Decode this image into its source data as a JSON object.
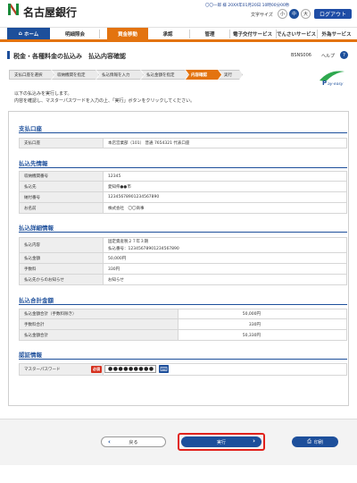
{
  "header": {
    "bank_name": "名古屋銀行",
    "user_name": "〇〇一郎 様",
    "last_login": "20XX年01月20日 10時00分00秒",
    "font_size_label": "文字サイズ",
    "font_sizes": [
      "小",
      "中",
      "大"
    ],
    "logout": "ログアウト"
  },
  "nav": {
    "items": [
      "ホーム",
      "明細照会",
      "資金移動",
      "承認",
      "管理",
      "電子交付サービス",
      "でんさいサービス",
      "外為サービス"
    ]
  },
  "page": {
    "title": "税金・各種料金の払込み　払込内容確認",
    "screen_id": "BSNS006",
    "help": "ヘルプ"
  },
  "steps": [
    "支払口座を選択",
    "収納機関を指定",
    "払込情報を入力",
    "払込金額を指定",
    "内容確認",
    "実行"
  ],
  "instructions": [
    "以下の払込みを実行します。",
    "内容を確認し、マスターパスワードを入力の上、「実行」ボタンをクリックしてください。"
  ],
  "sections": {
    "account": {
      "title": "支払口座",
      "rows": [
        {
          "label": "支払口座",
          "value": "本店営業部（101） 普通 7654321 代表口座"
        }
      ]
    },
    "payee": {
      "title": "払込先情報",
      "rows": [
        {
          "label": "収納機関番号",
          "value": "12345"
        },
        {
          "label": "払込先",
          "value": "愛知県●●市"
        },
        {
          "label": "納付番号",
          "value": "12345678901234567890"
        },
        {
          "label": "お名前",
          "value": "株式会社　〇〇商事"
        }
      ]
    },
    "detail": {
      "title": "払込詳細情報",
      "rows": [
        {
          "label": "払込内容",
          "value": "固定資産税２７年３期",
          "value2": "払込番号：12345678901234567890"
        },
        {
          "label": "払込金額",
          "value": "50,000円"
        },
        {
          "label": "手数料",
          "value": "330円"
        },
        {
          "label": "払込先からのお知らせ",
          "value": "お知らせ"
        }
      ]
    },
    "total": {
      "title": "払込合計金額",
      "rows": [
        {
          "label": "払込金額合計（手数料除き）",
          "value": "50,000円"
        },
        {
          "label": "手数料合計",
          "value": "330円"
        },
        {
          "label": "払込金額合計",
          "value": "50,330円"
        }
      ]
    },
    "auth": {
      "title": "認証情報",
      "label": "マスターパスワード",
      "required": "必須",
      "password_value": "●●●●●●●●●"
    }
  },
  "buttons": {
    "back": "戻る",
    "execute": "実行",
    "print": "印刷"
  },
  "colors": {
    "brand_blue": "#1d4f9b",
    "accent_orange": "#e3730f",
    "highlight_red": "#e1211b"
  }
}
